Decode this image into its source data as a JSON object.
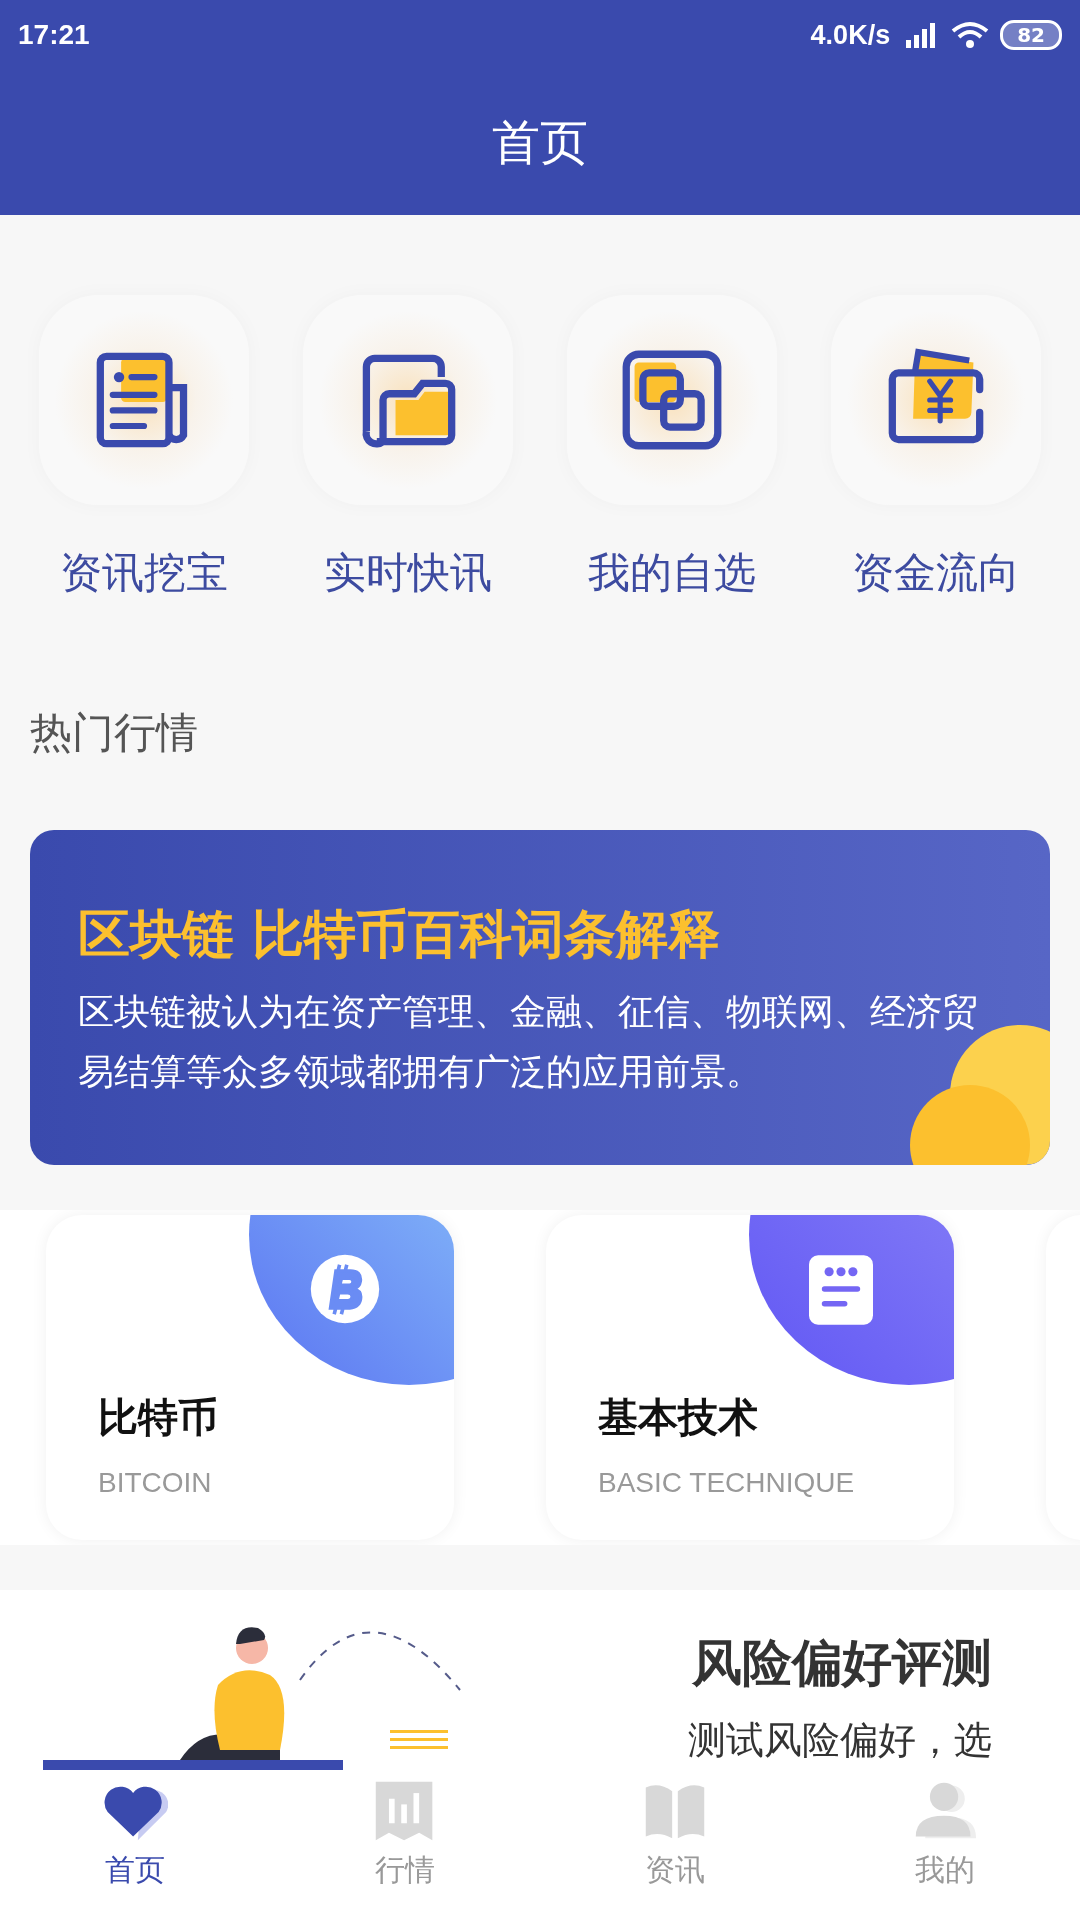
{
  "status_bar": {
    "time": "17:21",
    "net_speed": "4.0K/s",
    "battery": "82"
  },
  "header": {
    "title": "首页"
  },
  "shortcuts": [
    {
      "label": "资讯挖宝",
      "kind": "news"
    },
    {
      "label": "实时快讯",
      "kind": "folder"
    },
    {
      "label": "我的自选",
      "kind": "link"
    },
    {
      "label": "资金流向",
      "kind": "wallet"
    }
  ],
  "section_title": "热门行情",
  "banner": {
    "title": "区块链 比特币百科词条解释",
    "description": "区块链被认为在资产管理、金融、征信、物联网、经济贸易结算等众多领域都拥有广泛的应用前景。"
  },
  "categories": [
    {
      "title": "比特币",
      "subtitle": "BITCOIN",
      "kind": "bitcoin"
    },
    {
      "title": "基本技术",
      "subtitle": "BASIC TECHNIQUE",
      "kind": "document"
    }
  ],
  "promo": {
    "title": "风险偏好评测",
    "description": "测试风险偏好，选"
  },
  "tabs": [
    {
      "label": "首页",
      "selected": true,
      "kind": "heart"
    },
    {
      "label": "行情",
      "selected": false,
      "kind": "chart"
    },
    {
      "label": "资讯",
      "selected": false,
      "kind": "book"
    },
    {
      "label": "我的",
      "selected": false,
      "kind": "person"
    }
  ]
}
